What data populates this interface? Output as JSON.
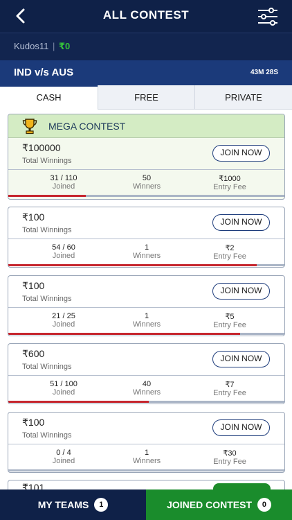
{
  "header": {
    "title": "ALL CONTEST"
  },
  "user": {
    "name": "Kudos11",
    "separator": "|",
    "balance": "₹0"
  },
  "match": {
    "name": "IND v/s AUS",
    "timer": "43M 28S"
  },
  "tabs": [
    {
      "label": "CASH",
      "active": true
    },
    {
      "label": "FREE",
      "active": false
    },
    {
      "label": "PRIVATE",
      "active": false
    }
  ],
  "mega": {
    "label": "MEGA CONTEST"
  },
  "contests": [
    {
      "prize": "₹100000",
      "prize_label": "Total Winnings",
      "join_label": "JOIN NOW",
      "joined": "31 / 110",
      "joined_label": "Joined",
      "winners": "50",
      "winners_label": "Winners",
      "fee": "₹1000",
      "fee_label": "Entry Fee",
      "fill_fraction": 0.28
    },
    {
      "prize": "₹100",
      "prize_label": "Total Winnings",
      "join_label": "JOIN NOW",
      "joined": "54 / 60",
      "joined_label": "Joined",
      "winners": "1",
      "winners_label": "Winners",
      "fee": "₹2",
      "fee_label": "Entry Fee",
      "fill_fraction": 0.9
    },
    {
      "prize": "₹100",
      "prize_label": "Total Winnings",
      "join_label": "JOIN NOW",
      "joined": "21 / 25",
      "joined_label": "Joined",
      "winners": "1",
      "winners_label": "Winners",
      "fee": "₹5",
      "fee_label": "Entry Fee",
      "fill_fraction": 0.84
    },
    {
      "prize": "₹600",
      "prize_label": "Total Winnings",
      "join_label": "JOIN NOW",
      "joined": "51 / 100",
      "joined_label": "Joined",
      "winners": "40",
      "winners_label": "Winners",
      "fee": "₹7",
      "fee_label": "Entry Fee",
      "fill_fraction": 0.51
    },
    {
      "prize": "₹100",
      "prize_label": "Total Winnings",
      "join_label": "JOIN NOW",
      "joined": "0 / 4",
      "joined_label": "Joined",
      "winners": "1",
      "winners_label": "Winners",
      "fee": "₹30",
      "fee_label": "Entry Fee",
      "fill_fraction": 0
    }
  ],
  "partial_card": {
    "prize": "₹101"
  },
  "bottom": {
    "my_teams_label": "MY TEAMS",
    "my_teams_count": "1",
    "joined_label": "JOINED CONTEST",
    "joined_count": "0"
  },
  "colors": {
    "navy": "#0f2148",
    "green": "#1a8c2c",
    "progress_red": "#c6262e",
    "mega_green": "#d4ecc4"
  },
  "icons": {
    "back": "chevron-left-icon",
    "filter": "filter-sliders-icon",
    "trophy": "trophy-icon"
  }
}
